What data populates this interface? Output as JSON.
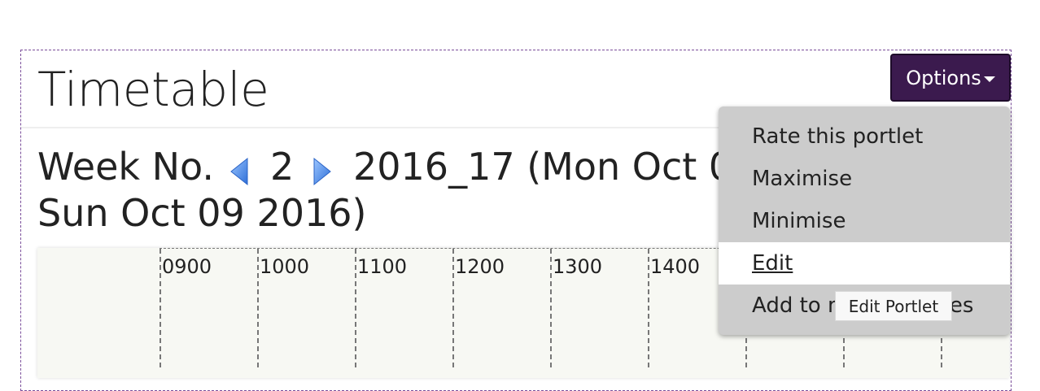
{
  "portlet": {
    "title": "Timetable",
    "options_label": "Options",
    "week": {
      "label": "Week No.",
      "number": "2",
      "range_line1": "2016_17 (Mon Oct 03",
      "range_line2": "Sun Oct 09 2016)"
    },
    "hours": [
      "0900",
      "1000",
      "1100",
      "1200",
      "1300",
      "1400"
    ]
  },
  "menu": {
    "items": [
      {
        "label": "Rate this portlet"
      },
      {
        "label": "Maximise"
      },
      {
        "label": "Minimise"
      },
      {
        "label": "Edit"
      },
      {
        "label": "Add to my favourites"
      }
    ]
  },
  "tooltip": {
    "text": "Edit Portlet"
  },
  "colors": {
    "accent": "#3b1a4e",
    "portlet_border": "#7a4e9a",
    "menu_bg": "#cccccc",
    "grid_bg": "#f7f8f3"
  },
  "icons": {
    "prev": "triangle-left-icon",
    "next": "triangle-right-icon",
    "caret": "caret-down-icon"
  }
}
